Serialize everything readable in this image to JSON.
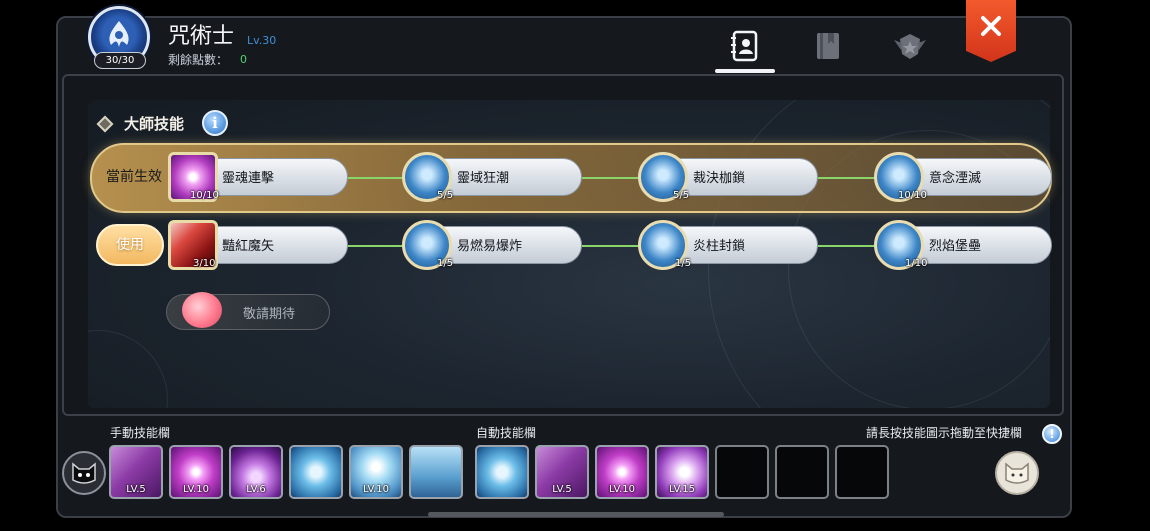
{
  "header": {
    "class_name": "咒術士",
    "class_level": "Lv.30",
    "skill_points_badge": "30/30",
    "remaining_points_label": "剩餘點數：",
    "remaining_points_value": "0"
  },
  "tabs": [
    {
      "icon": "skill-book-icon",
      "active": true
    },
    {
      "icon": "book-icon",
      "active": false
    },
    {
      "icon": "crest-icon",
      "active": false
    }
  ],
  "master_skills": {
    "title": "大師技能",
    "info_icon": "i",
    "rows": [
      {
        "label": "當前生效",
        "state": "active",
        "nodes": [
          {
            "name": "靈魂連擊",
            "level": "10/10",
            "icon": "magenta-burst-icon"
          },
          {
            "name": "靈域狂潮",
            "level": "5/5",
            "icon": "blue-crystal-icon"
          },
          {
            "name": "裁決枷鎖",
            "level": "5/5",
            "icon": "blue-crystal-icon"
          },
          {
            "name": "意念湮滅",
            "level": "10/10",
            "icon": "blue-crystal-icon"
          }
        ]
      },
      {
        "label": "使用",
        "state": "button",
        "nodes": [
          {
            "name": "豔紅魔矢",
            "level": "3/10",
            "icon": "red-arrow-icon"
          },
          {
            "name": "易燃易爆炸",
            "level": "1/5",
            "icon": "blue-crystal-icon"
          },
          {
            "name": "炎柱封鎖",
            "level": "1/5",
            "icon": "blue-crystal-icon"
          },
          {
            "name": "烈焰堡壘",
            "level": "1/10",
            "icon": "blue-crystal-icon"
          }
        ]
      }
    ],
    "coming_soon": "敬請期待"
  },
  "skill_bar": {
    "manual_label": "手動技能欄",
    "auto_label": "自動技能欄",
    "hint": "請長按技能圖示拖動至快捷欄",
    "hint_icon": "!",
    "manual_slots": [
      {
        "icon": "purple-cube-icon",
        "level": "LV.5"
      },
      {
        "icon": "magenta-burst-icon",
        "level": "LV.10"
      },
      {
        "icon": "purple-orb-icon",
        "level": "LV.6"
      },
      {
        "icon": "blue-arrows-icon",
        "level": ""
      },
      {
        "icon": "blue-eye-icon",
        "level": "LV.10"
      },
      {
        "icon": "blue-figure-icon",
        "level": ""
      }
    ],
    "auto_slots": [
      {
        "icon": "blue-arrows-icon",
        "level": ""
      },
      {
        "icon": "purple-cube-icon",
        "level": "LV.5"
      },
      {
        "icon": "magenta-burst-icon",
        "level": "LV.10"
      },
      {
        "icon": "purple-leaf-icon",
        "level": "LV.15"
      },
      {
        "icon": "empty-slot",
        "level": ""
      },
      {
        "icon": "empty-slot",
        "level": ""
      },
      {
        "icon": "empty-slot",
        "level": ""
      }
    ]
  },
  "colors": {
    "accent_blue": "#3f8fd6",
    "points_green": "#4bd26f",
    "active_gold": "#e2c98a",
    "close_red": "#e2431f",
    "connector_green": "#8ad56a"
  }
}
